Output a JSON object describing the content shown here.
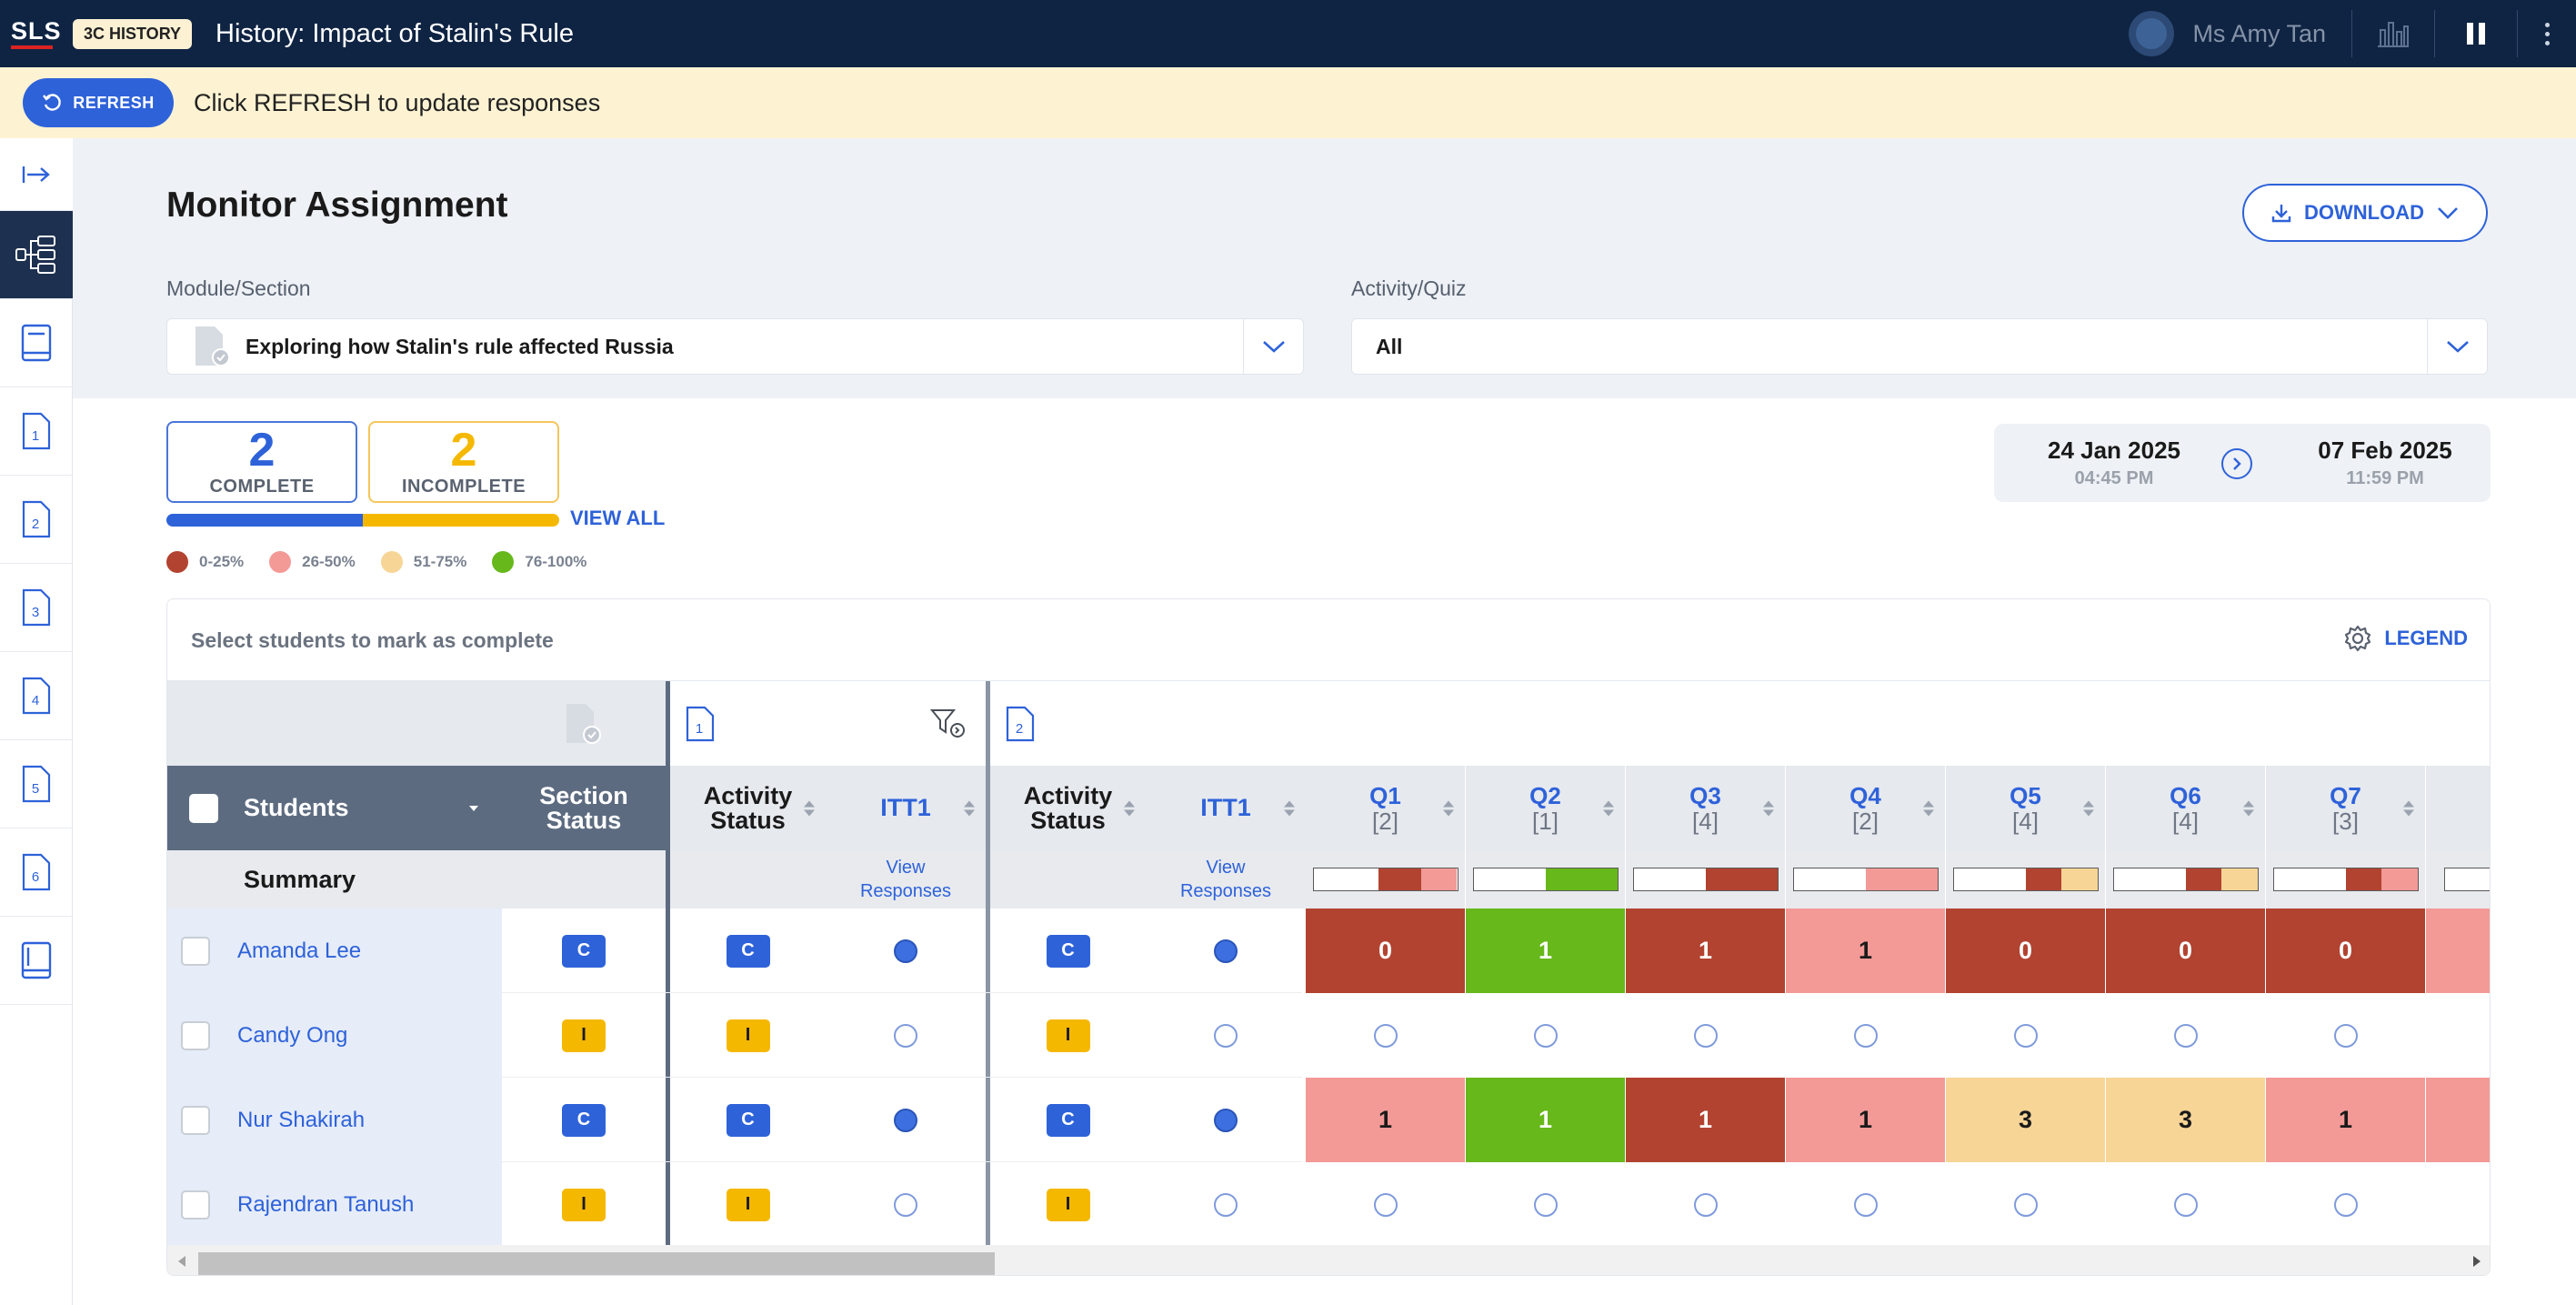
{
  "app": {
    "logo": "SLS",
    "class_badge": "3C HISTORY",
    "title": "History: Impact of Stalin's Rule",
    "user_name": "Ms Amy Tan"
  },
  "banner": {
    "refresh_label": "REFRESH",
    "message": "Click REFRESH to update responses"
  },
  "page": {
    "title": "Monitor Assignment",
    "download_label": "DOWNLOAD",
    "module_label": "Module/Section",
    "module_value": "Exploring how Stalin's rule affected Russia",
    "activity_label": "Activity/Quiz",
    "activity_value": "All"
  },
  "progress": {
    "complete_count": "2",
    "complete_label": "COMPLETE",
    "incomplete_count": "2",
    "incomplete_label": "INCOMPLETE",
    "complete_fraction": 0.5,
    "view_all": "VIEW ALL",
    "legend": [
      {
        "label": "0-25%",
        "color": "#b24330"
      },
      {
        "label": "26-50%",
        "color": "#f39a97"
      },
      {
        "label": "51-75%",
        "color": "#f7d596"
      },
      {
        "label": "76-100%",
        "color": "#67b81b"
      }
    ]
  },
  "dates": {
    "start_date": "24 Jan 2025",
    "start_time": "04:45 PM",
    "end_date": "07 Feb 2025",
    "end_time": "11:59 PM"
  },
  "table": {
    "hint": "Select students to mark as complete",
    "legend_label": "LEGEND",
    "group1_number": "1",
    "group2_number": "2",
    "headers": {
      "students": "Students",
      "section_status_1": "Section",
      "section_status_2": "Status",
      "activity_status_1": "Activity",
      "activity_status_2": "Status",
      "itt": "ITT1"
    },
    "summary_label": "Summary",
    "view_responses_1": "View",
    "view_responses_2": "Responses",
    "questions": [
      {
        "label": "Q1",
        "marks": "[2]",
        "summary": [
          [
            0.45,
            "#ffffff"
          ],
          [
            0.3,
            "#b24330"
          ],
          [
            0.25,
            "#f39a97"
          ]
        ]
      },
      {
        "label": "Q2",
        "marks": "[1]",
        "summary": [
          [
            0.5,
            "#ffffff"
          ],
          [
            0.5,
            "#67b81b"
          ]
        ]
      },
      {
        "label": "Q3",
        "marks": "[4]",
        "summary": [
          [
            0.5,
            "#ffffff"
          ],
          [
            0.5,
            "#b24330"
          ]
        ]
      },
      {
        "label": "Q4",
        "marks": "[2]",
        "summary": [
          [
            0.5,
            "#ffffff"
          ],
          [
            0.5,
            "#f39a97"
          ]
        ]
      },
      {
        "label": "Q5",
        "marks": "[4]",
        "summary": [
          [
            0.5,
            "#ffffff"
          ],
          [
            0.25,
            "#b24330"
          ],
          [
            0.25,
            "#f7d596"
          ]
        ]
      },
      {
        "label": "Q6",
        "marks": "[4]",
        "summary": [
          [
            0.5,
            "#ffffff"
          ],
          [
            0.25,
            "#b24330"
          ],
          [
            0.25,
            "#f7d596"
          ]
        ]
      },
      {
        "label": "Q7",
        "marks": "[3]",
        "summary": [
          [
            0.5,
            "#ffffff"
          ],
          [
            0.25,
            "#b24330"
          ],
          [
            0.25,
            "#f39a97"
          ]
        ]
      }
    ],
    "students": [
      {
        "name": "Amanda Lee",
        "section": "C",
        "act1": "C",
        "itt1": true,
        "act2": "C",
        "itt2": true,
        "scores": [
          [
            "0",
            "#b24330"
          ],
          [
            "1",
            "#67b81b"
          ],
          [
            "1",
            "#b24330"
          ],
          [
            "1",
            "#f39a97"
          ],
          [
            "0",
            "#b24330"
          ],
          [
            "0",
            "#b24330"
          ],
          [
            "0",
            "#b24330"
          ]
        ],
        "q8_color": "#f39a97"
      },
      {
        "name": "Candy Ong",
        "section": "I",
        "act1": "I",
        "itt1": false,
        "act2": "I",
        "itt2": false,
        "scores": [],
        "q8_color": ""
      },
      {
        "name": "Nur Shakirah",
        "section": "C",
        "act1": "C",
        "itt1": true,
        "act2": "C",
        "itt2": true,
        "scores": [
          [
            "1",
            "#f39a97"
          ],
          [
            "1",
            "#67b81b"
          ],
          [
            "1",
            "#b24330"
          ],
          [
            "1",
            "#f39a97"
          ],
          [
            "3",
            "#f7d596"
          ],
          [
            "3",
            "#f7d596"
          ],
          [
            "1",
            "#f39a97"
          ]
        ],
        "q8_color": "#f39a97"
      },
      {
        "name": "Rajendran Tanush",
        "section": "I",
        "act1": "I",
        "itt1": false,
        "act2": "I",
        "itt2": false,
        "scores": [],
        "q8_color": ""
      }
    ]
  }
}
